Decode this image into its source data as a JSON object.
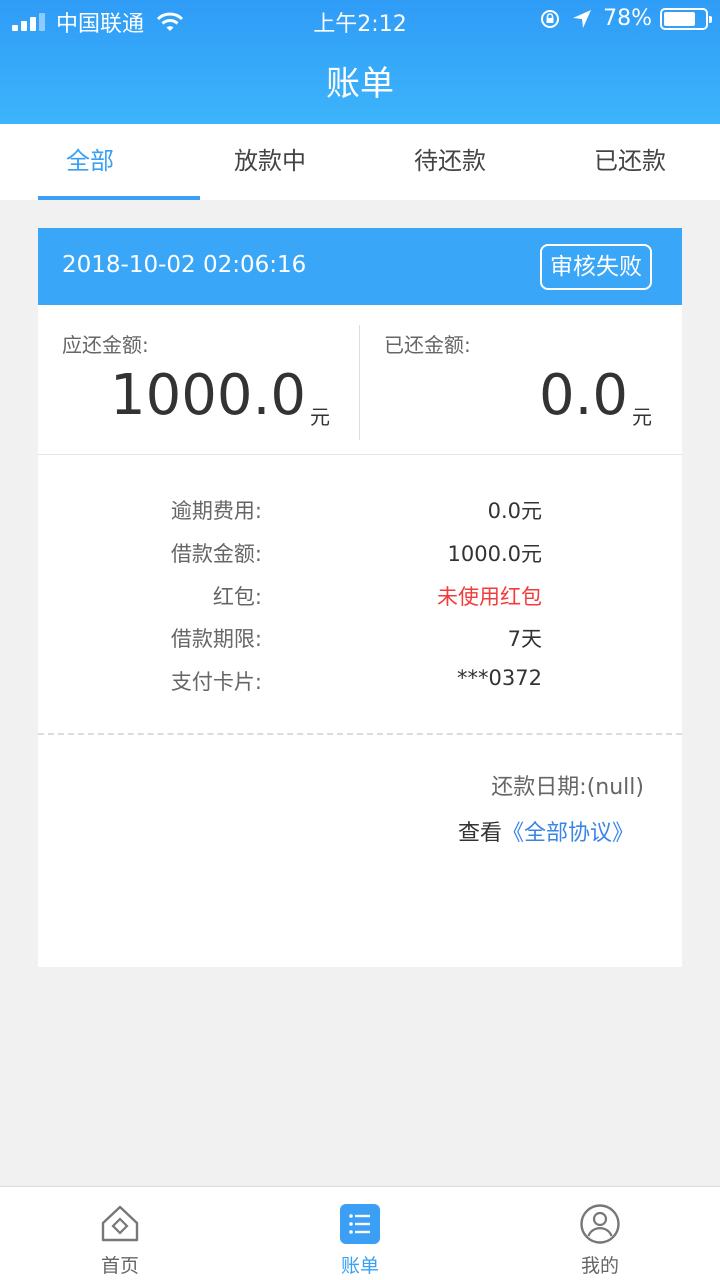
{
  "status_bar": {
    "carrier": "中国联通",
    "time": "上午2:12",
    "battery": "78%",
    "battery_level": 0.78
  },
  "header": {
    "title": "账单"
  },
  "tabs": [
    {
      "label": "全部",
      "active": true
    },
    {
      "label": "放款中",
      "active": false
    },
    {
      "label": "待还款",
      "active": false
    },
    {
      "label": "已还款",
      "active": false
    }
  ],
  "bill": {
    "datetime": "2018-10-02 02:06:16",
    "status": "审核失败",
    "due_label": "应还金额:",
    "due_value": "1000.0",
    "due_unit": "元",
    "paid_label": "已还金额:",
    "paid_value": "0.0",
    "paid_unit": "元",
    "details": [
      {
        "label": "逾期费用:",
        "value": "0.0元"
      },
      {
        "label": "借款金额:",
        "value": "1000.0元"
      },
      {
        "label": "红包:",
        "value": "未使用红包"
      },
      {
        "label": "借款期限:",
        "value": "7天"
      },
      {
        "label": "支付卡片:",
        "value": "***0372"
      }
    ],
    "repay_date": "还款日期:(null)",
    "agreement_prefix": "查看",
    "agreement_link": "《全部协议》"
  },
  "bottom_nav": [
    {
      "label": "首页",
      "icon": "home-icon",
      "active": false
    },
    {
      "label": "账单",
      "icon": "bill-list-icon",
      "active": true
    },
    {
      "label": "我的",
      "icon": "profile-icon",
      "active": false
    }
  ],
  "colors": {
    "primary": "#3a9ff5",
    "header": "#3db4fb",
    "alert_red": "#f23c3c",
    "link": "#3a85e6"
  }
}
